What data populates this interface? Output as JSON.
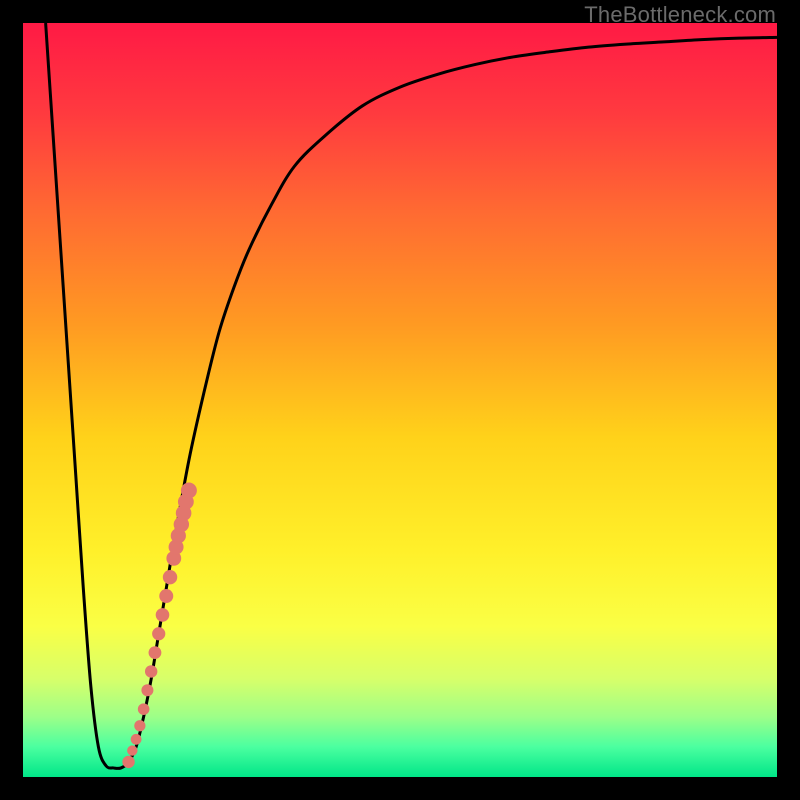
{
  "watermark": "TheBottleneck.com",
  "colors": {
    "frame": "#000000",
    "curve": "#000000",
    "dots": "#e2766d",
    "gradient_stops": [
      {
        "offset": 0.0,
        "color": "#ff1a45"
      },
      {
        "offset": 0.12,
        "color": "#ff3a3f"
      },
      {
        "offset": 0.25,
        "color": "#ff6a32"
      },
      {
        "offset": 0.4,
        "color": "#ff9a22"
      },
      {
        "offset": 0.55,
        "color": "#ffd21a"
      },
      {
        "offset": 0.7,
        "color": "#fff02a"
      },
      {
        "offset": 0.8,
        "color": "#faff45"
      },
      {
        "offset": 0.87,
        "color": "#d7ff6a"
      },
      {
        "offset": 0.92,
        "color": "#9dff88"
      },
      {
        "offset": 0.96,
        "color": "#4bffa0"
      },
      {
        "offset": 1.0,
        "color": "#00e688"
      }
    ]
  },
  "chart_data": {
    "type": "line",
    "title": "",
    "xlabel": "",
    "ylabel": "",
    "xlim": [
      0,
      100
    ],
    "ylim": [
      0,
      100
    ],
    "series": [
      {
        "name": "bottleneck-curve",
        "x": [
          3,
          4,
          5,
          6,
          7,
          8,
          9,
          10,
          11,
          12,
          13,
          14,
          15,
          16,
          17,
          18,
          19,
          20,
          22,
          24,
          26,
          28,
          30,
          33,
          36,
          40,
          45,
          50,
          55,
          60,
          65,
          70,
          75,
          80,
          85,
          90,
          95,
          100
        ],
        "y": [
          100,
          85,
          70,
          55,
          40,
          25,
          12,
          4,
          1.5,
          1.2,
          1.2,
          2,
          4,
          8,
          13,
          19,
          25,
          31,
          42,
          51,
          59,
          65,
          70,
          76,
          81,
          85,
          89,
          91.5,
          93.2,
          94.5,
          95.5,
          96.2,
          96.8,
          97.2,
          97.5,
          97.8,
          98.0,
          98.1
        ]
      }
    ],
    "dot_cluster": {
      "name": "highlight-dots",
      "x": [
        14.0,
        14.5,
        15.0,
        15.5,
        16.0,
        16.5,
        17.0,
        17.5,
        18.0,
        18.5,
        19.0,
        19.5,
        20.0,
        20.3,
        20.6,
        21.0,
        21.3,
        21.6,
        22.0
      ],
      "y": [
        2.0,
        3.5,
        5.0,
        6.8,
        9.0,
        11.5,
        14.0,
        16.5,
        19.0,
        21.5,
        24.0,
        26.5,
        29.0,
        30.5,
        32.0,
        33.5,
        35.0,
        36.5,
        38.0
      ],
      "r": [
        6.2,
        5.2,
        5.4,
        5.6,
        5.8,
        6.0,
        6.2,
        6.4,
        6.6,
        6.8,
        7.0,
        7.2,
        7.4,
        7.5,
        7.6,
        7.7,
        7.8,
        7.9,
        8.0
      ]
    }
  }
}
